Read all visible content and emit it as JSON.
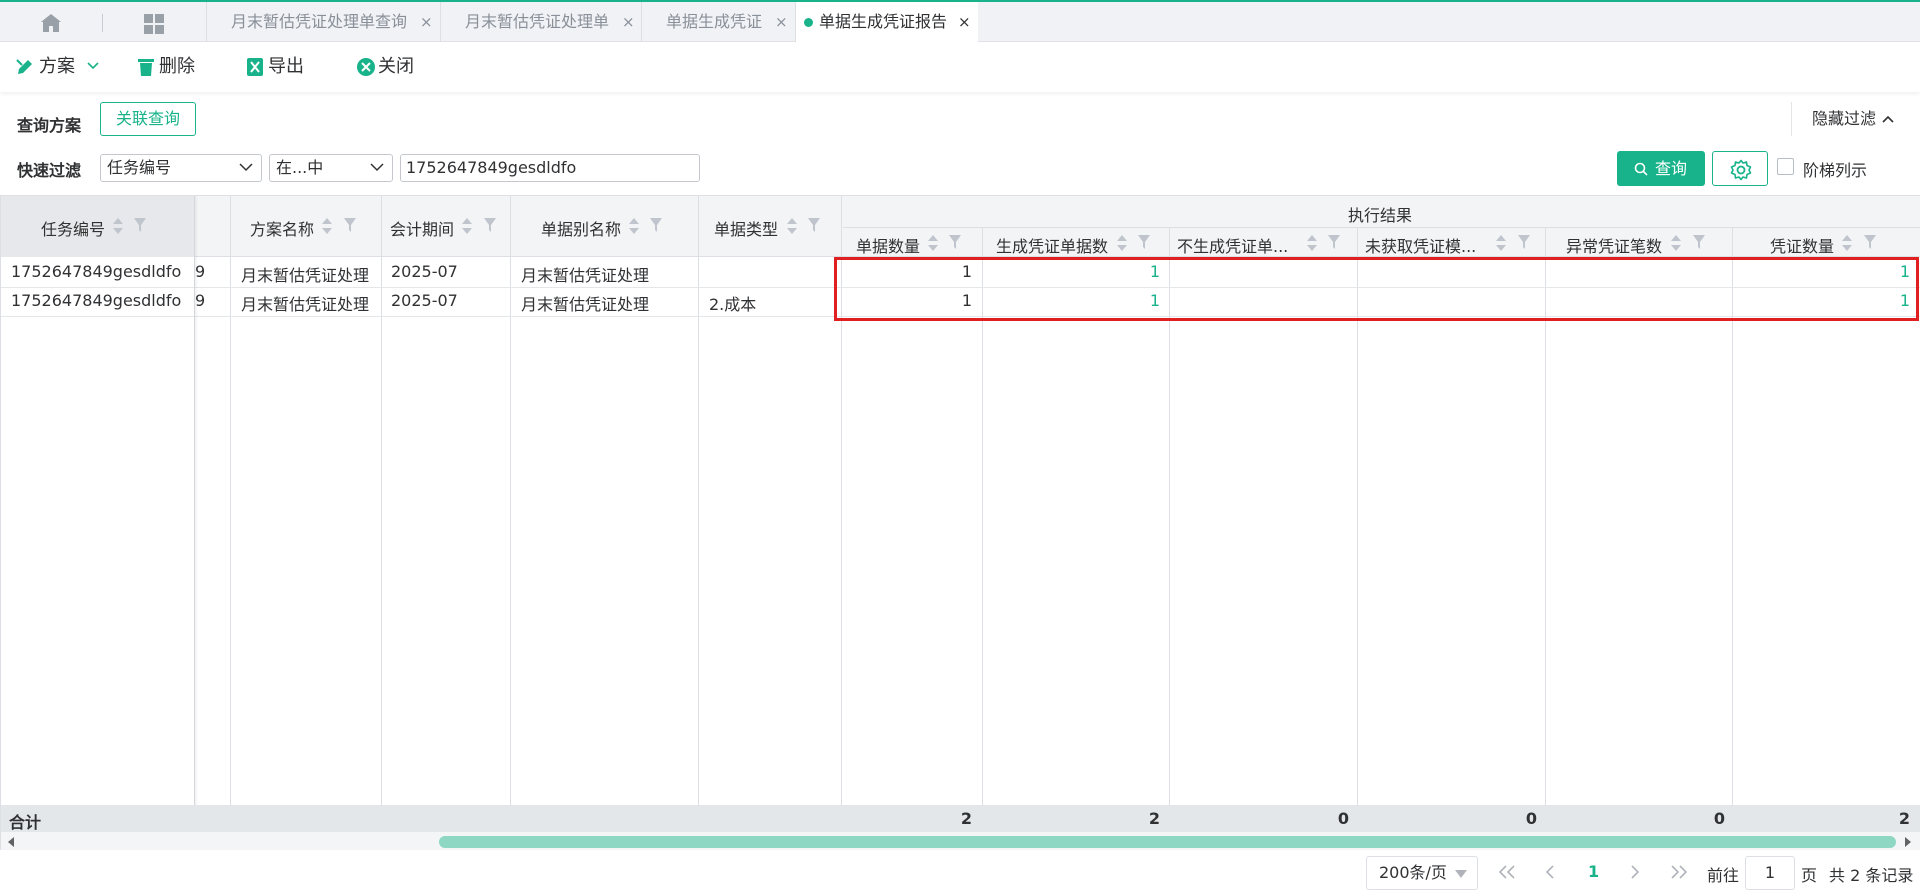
{
  "tabs": [
    {
      "label": "月末暂估凭证处理单查询",
      "closable": true
    },
    {
      "label": "月末暂估凭证处理单",
      "closable": true
    },
    {
      "label": "单据生成凭证",
      "closable": true
    },
    {
      "label": "单据生成凭证报告",
      "closable": true,
      "active": true
    }
  ],
  "tab_close_glyph": "×",
  "toolbar": {
    "scheme": "方案",
    "delete": "删除",
    "export": "导出",
    "close": "关闭"
  },
  "filter": {
    "query_scheme_label": "查询方案",
    "related_query_button": "关联查询",
    "hide_filter_button": "隐藏过滤",
    "quick_filter_label": "快速过滤",
    "field_select": "任务编号",
    "operator_select": "在...中",
    "value_input": "1752647849gesdldfo",
    "query_button": "查询",
    "ladder_checkbox_label": "阶梯列示",
    "ladder_checked": false
  },
  "table": {
    "group_header": "执行结果",
    "columns": {
      "task_no": "任务编号",
      "scheme_name": "方案名称",
      "period": "会计期间",
      "bill_alias": "单据别名称",
      "bill_type": "单据类型",
      "bill_count": "单据数量",
      "gen_count": "生成凭证单据数",
      "not_gen": "不生成凭证单...",
      "no_template": "未获取凭证模...",
      "abnormal": "异常凭证笔数",
      "voucher_count": "凭证数量"
    },
    "rows": [
      {
        "task_no": "1752647849gesdldfo",
        "hidden_tail": "9",
        "scheme_name": "月末暂估凭证处理",
        "period": "2025-07",
        "bill_alias": "月末暂估凭证处理",
        "bill_type": "",
        "bill_count": "1",
        "gen_count": "1",
        "not_gen": "",
        "no_template": "",
        "abnormal": "",
        "voucher_count": "1"
      },
      {
        "task_no": "1752647849gesdldfo",
        "hidden_tail": "9",
        "scheme_name": "月末暂估凭证处理",
        "period": "2025-07",
        "bill_alias": "月末暂估凭证处理",
        "bill_type": "2.成本",
        "bill_count": "1",
        "gen_count": "1",
        "not_gen": "",
        "no_template": "",
        "abnormal": "",
        "voucher_count": "1"
      }
    ],
    "summary": {
      "label": "合计",
      "bill_count": "2",
      "gen_count": "2",
      "not_gen": "0",
      "no_template": "0",
      "abnormal": "0",
      "voucher_count": "2"
    }
  },
  "pagination": {
    "page_size": "200条/页",
    "current_page": "1",
    "goto_label": "前往",
    "goto_value": "1",
    "page_unit": "页",
    "total_text": "共 2 条记录"
  },
  "colors": {
    "accent": "#18b38a",
    "highlight_border": "#e02020"
  }
}
